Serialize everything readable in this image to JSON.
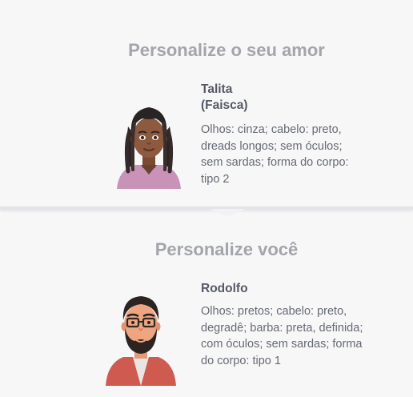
{
  "love": {
    "title": "Personalize o seu amor",
    "name": "Talita",
    "nickname": "(Faisca)",
    "description": "Olhos: cinza; cabelo: preto, dreads longos; sem óculos; sem sardas; forma do corpo: tipo 2"
  },
  "you": {
    "title": "Personalize você",
    "name": "Rodolfo",
    "description": "Olhos: pretos; cabelo: preto, degradê; barba: preta, definida; com óculos; sem sardas; forma do corpo: tipo 1"
  },
  "colors": {
    "accent": "#f0578d",
    "title_gray": "#a3a5ab",
    "name_gray": "#555966",
    "text_gray": "#666a74",
    "background": "#f7f7f8"
  }
}
